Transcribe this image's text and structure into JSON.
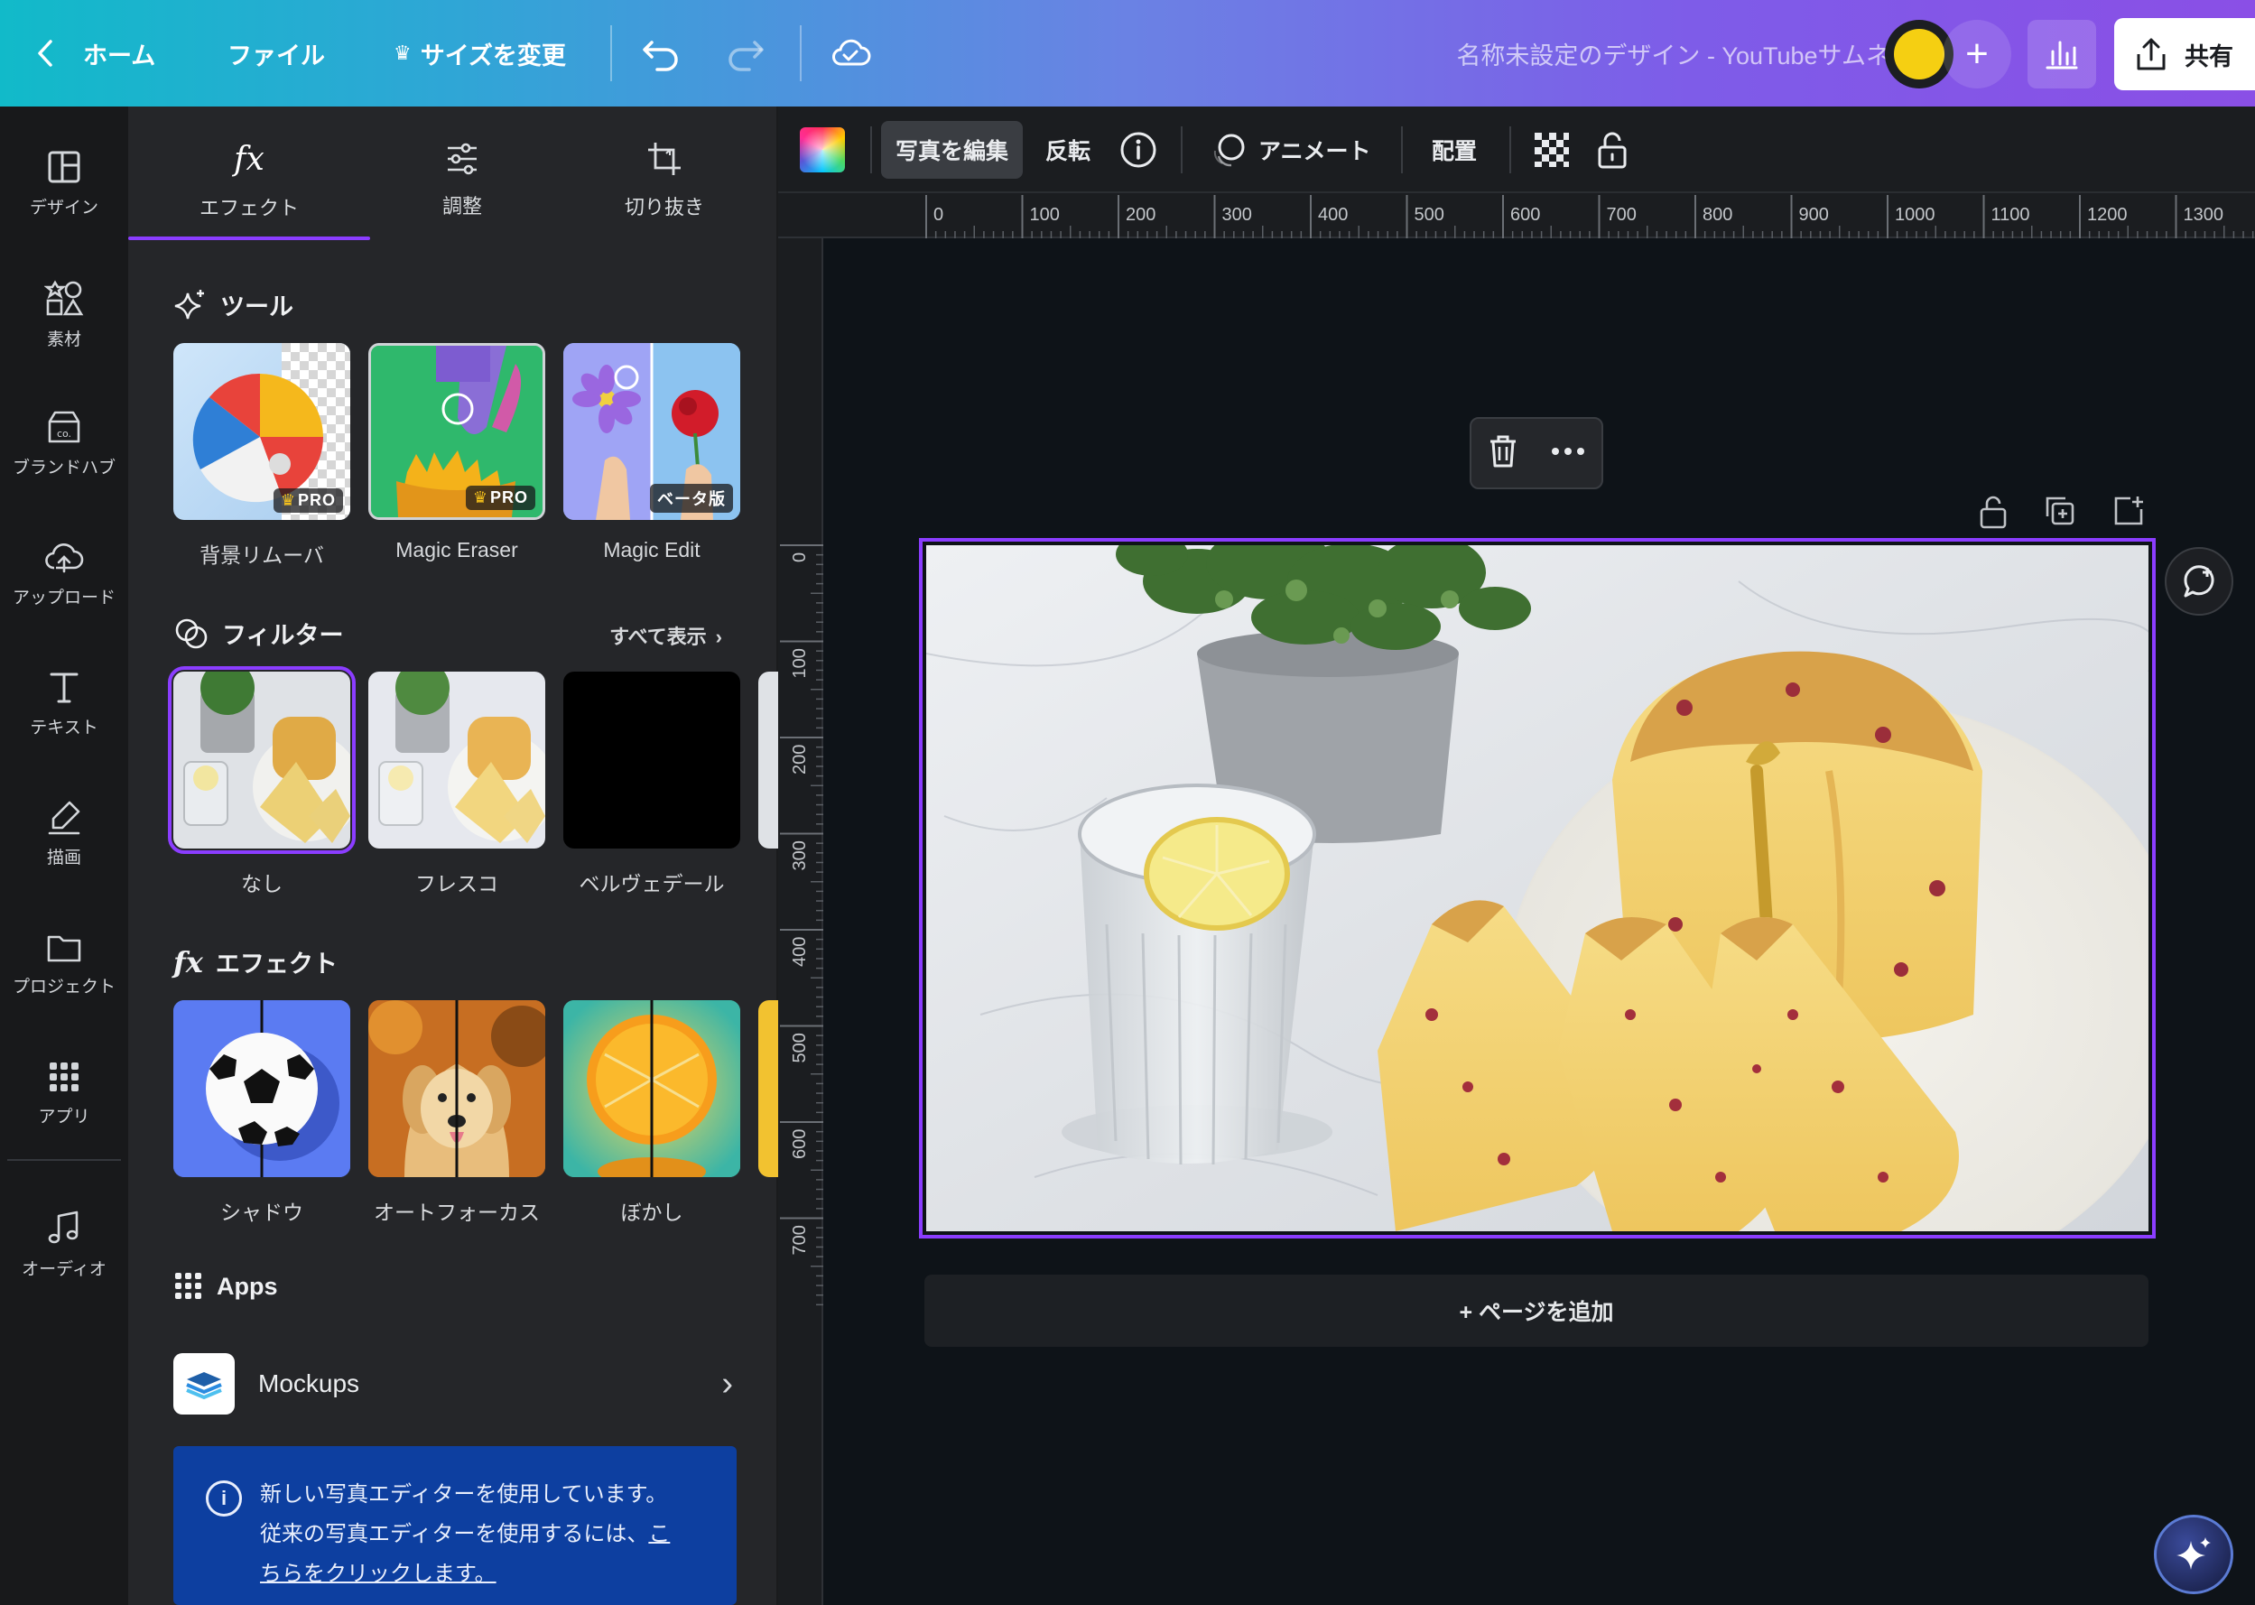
{
  "header": {
    "back_label": "ホーム",
    "file_label": "ファイル",
    "resize_label": "サイズを変更",
    "design_title": "名称未設定のデザイン - YouTubeサムネイル",
    "share_label": "共有"
  },
  "rail": {
    "items": [
      {
        "label": "デザイン",
        "icon": "layout-icon"
      },
      {
        "label": "素材",
        "icon": "elements-icon"
      },
      {
        "label": "ブランドハブ",
        "icon": "brand-hub-icon"
      },
      {
        "label": "アップロード",
        "icon": "upload-cloud-icon"
      },
      {
        "label": "テキスト",
        "icon": "text-icon"
      },
      {
        "label": "描画",
        "icon": "draw-icon"
      },
      {
        "label": "プロジェクト",
        "icon": "folder-icon"
      },
      {
        "label": "アプリ",
        "icon": "apps-grid-icon"
      },
      {
        "label": "オーディオ",
        "icon": "music-note-icon"
      }
    ]
  },
  "panel": {
    "tabs": [
      {
        "label": "エフェクト",
        "icon": "fx-icon"
      },
      {
        "label": "調整",
        "icon": "sliders-icon"
      },
      {
        "label": "切り抜き",
        "icon": "crop-icon"
      }
    ],
    "tools": {
      "heading": "ツール",
      "items": [
        {
          "label": "背景リムーバ",
          "badge": "PRO"
        },
        {
          "label": "Magic Eraser",
          "badge": "PRO"
        },
        {
          "label": "Magic Edit",
          "badge": "ベータ版"
        }
      ]
    },
    "filters": {
      "heading": "フィルター",
      "see_all": "すべて表示",
      "items": [
        {
          "label": "なし"
        },
        {
          "label": "フレスコ"
        },
        {
          "label": "ベルヴェデール"
        }
      ]
    },
    "effects": {
      "heading": "エフェクト",
      "items": [
        {
          "label": "シャドウ"
        },
        {
          "label": "オートフォーカス"
        },
        {
          "label": "ぼかし"
        }
      ]
    },
    "apps": {
      "heading": "Apps",
      "mockups_label": "Mockups"
    },
    "notice": {
      "line1": "新しい写真エディターを使用しています。",
      "line2_prefix": "従来の写真エディターを使用するには、",
      "link_part1": "こ",
      "link_part2": "ちらをクリックします。"
    }
  },
  "toolbar": {
    "edit_photo": "写真を編集",
    "flip": "反転",
    "animate": "アニメート",
    "position": "配置"
  },
  "ruler": {
    "x_ticks": [
      "0",
      "100",
      "200",
      "300",
      "400",
      "500",
      "600",
      "700",
      "800",
      "900",
      "1000",
      "1100",
      "1200",
      "1300"
    ],
    "y_ticks": [
      "0",
      "100",
      "200",
      "300",
      "400",
      "500",
      "600",
      "700"
    ]
  },
  "canvas": {
    "add_page_label": "+ ページを追加"
  },
  "colors": {
    "accent": "#8b3dff",
    "notice_bg": "#0d3fa0",
    "panel_bg": "#252629",
    "canvas_bg": "#0e1318"
  }
}
